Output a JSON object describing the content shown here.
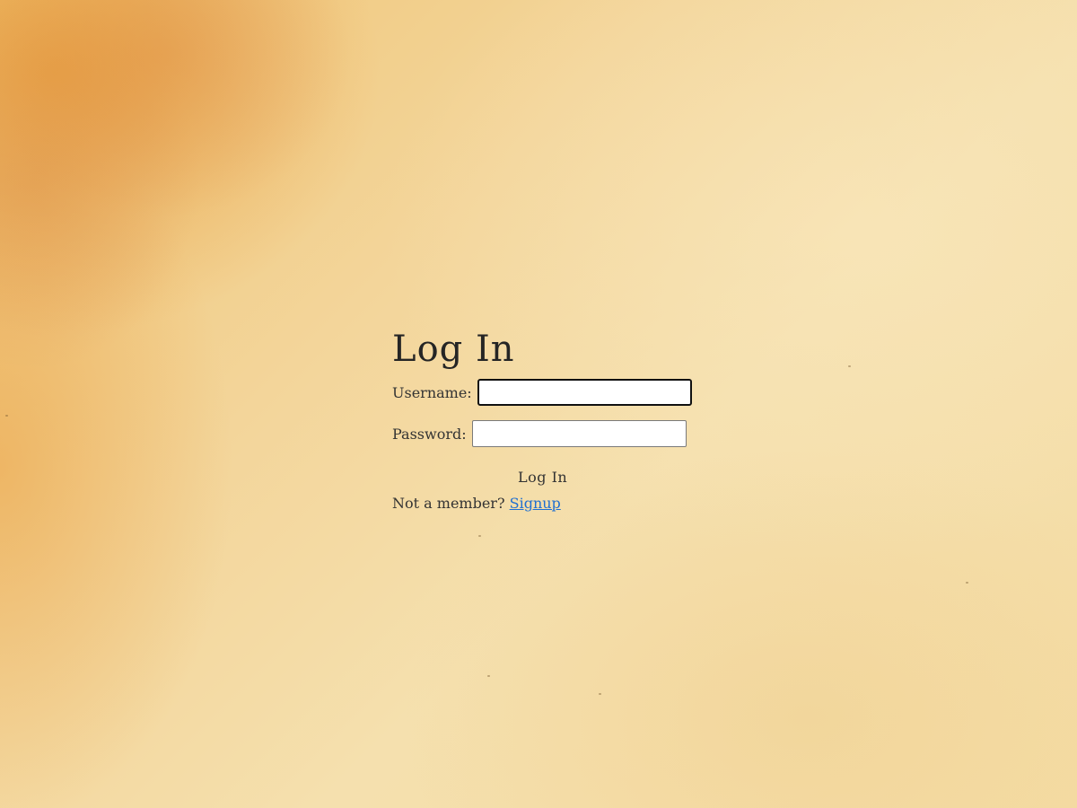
{
  "login": {
    "title": "Log In",
    "username_label": "Username:",
    "username_value": "",
    "password_label": "Password:",
    "password_value": "",
    "submit_label": "Log In",
    "signup_prompt": "Not a member?",
    "signup_link": "Signup"
  },
  "colors": {
    "link": "#1f6fd1",
    "text": "#2b2b2b",
    "background_accent": "#f0c474"
  }
}
